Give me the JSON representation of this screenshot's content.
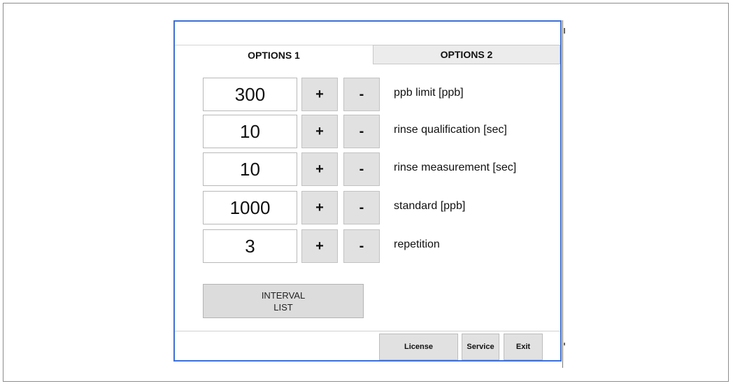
{
  "tabs": [
    {
      "label": "OPTIONS 1",
      "active": true
    },
    {
      "label": "OPTIONS 2",
      "active": false
    }
  ],
  "rows": [
    {
      "value": "300",
      "plus": "+",
      "minus": "-",
      "label": "ppb limit [ppb]"
    },
    {
      "value": "10",
      "plus": "+",
      "minus": "-",
      "label": "rinse qualification [sec]"
    },
    {
      "value": "10",
      "plus": "+",
      "minus": "-",
      "label": "rinse measurement [sec]"
    },
    {
      "value": "1000",
      "plus": "+",
      "minus": "-",
      "label": "standard [ppb]"
    },
    {
      "value": "3",
      "plus": "+",
      "minus": "-",
      "label": "repetition"
    }
  ],
  "interval_button": {
    "line1": "INTERVAL",
    "line2": "LIST"
  },
  "footer": {
    "license": "License",
    "service": "Service",
    "exit": "Exit"
  },
  "colors": {
    "window_border": "#3d6fd6",
    "button_bg": "#e1e1e1"
  }
}
